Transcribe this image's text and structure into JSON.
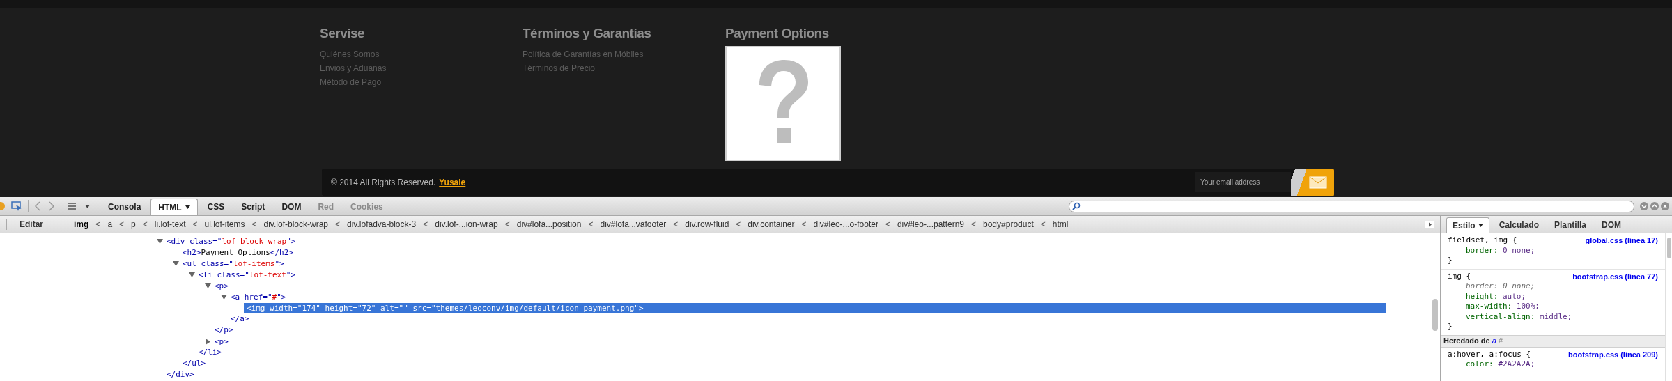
{
  "footer": {
    "columns": [
      {
        "kind": "links",
        "heading": "Servise",
        "links": [
          "Quiénes Somos",
          "Envios y Aduanas",
          "Método de Pago"
        ]
      },
      {
        "kind": "links",
        "heading": "Términos y Garantías",
        "links": [
          "Política de Garantías en Móbiles",
          "Términos de Precio"
        ]
      },
      {
        "kind": "image",
        "heading": "Payment Options"
      }
    ],
    "copyright": "© 2014 All Rights Reserved.",
    "brand_link": "Yusale",
    "email_placeholder": "Your email address"
  },
  "toolbar": {
    "tabs": [
      {
        "label": "Consola",
        "selected": false,
        "disabled": false,
        "dropdown": false
      },
      {
        "label": "HTML",
        "selected": true,
        "disabled": false,
        "dropdown": true
      },
      {
        "label": "CSS",
        "selected": false,
        "disabled": false,
        "dropdown": false
      },
      {
        "label": "Script",
        "selected": false,
        "disabled": false,
        "dropdown": false
      },
      {
        "label": "DOM",
        "selected": false,
        "disabled": false,
        "dropdown": false
      },
      {
        "label": "Red",
        "selected": false,
        "disabled": true,
        "dropdown": false
      },
      {
        "label": "Cookies",
        "selected": false,
        "disabled": true,
        "dropdown": false
      }
    ]
  },
  "breadcrumb": {
    "edit_button": "Editar",
    "crumbs": [
      {
        "label": "img",
        "selected": true
      },
      {
        "separator": "<",
        "label": "a",
        "selected": false
      },
      {
        "separator": "<",
        "label": "p",
        "selected": false
      },
      {
        "separator": "<",
        "label": "li.lof-text",
        "selected": false
      },
      {
        "separator": "<",
        "label": "ul.lof-items",
        "selected": false
      },
      {
        "separator": "<",
        "label": "div.lof-block-wrap",
        "selected": false
      },
      {
        "separator": "<",
        "label": "div.lofadva-block-3",
        "selected": false
      },
      {
        "separator": "<",
        "label": "div.lof-...ion-wrap",
        "selected": false
      },
      {
        "separator": "<",
        "label": "div#lofa...position",
        "selected": false
      },
      {
        "separator": "<",
        "label": "div#lofa...vafooter",
        "selected": false
      },
      {
        "separator": "<",
        "label": "div.row-fluid",
        "selected": false
      },
      {
        "separator": "<",
        "label": "div.container",
        "selected": false
      },
      {
        "separator": "<",
        "label": "div#leo-...o-footer",
        "selected": false
      },
      {
        "separator": "<",
        "label": "div#leo-...pattern9",
        "selected": false
      },
      {
        "separator": "<",
        "label": "body#product",
        "selected": false
      },
      {
        "separator": "<",
        "label": "html",
        "selected": false
      }
    ]
  },
  "html_tree": [
    {
      "markup": "<div class=\"lof-block-wrap\">",
      "expanded": true,
      "selected": false,
      "close": "</div>",
      "children": [
        {
          "markup": "<h2>Payment Options</h2>",
          "selected": false
        },
        {
          "markup": "<ul class=\"lof-items\">",
          "expanded": true,
          "selected": false,
          "close": "</ul>",
          "children": [
            {
              "markup": "<li class=\"lof-text\">",
              "expanded": true,
              "selected": false,
              "close": "</li>",
              "children": [
                {
                  "markup": "<p>",
                  "expanded": true,
                  "selected": false,
                  "close": "</p>",
                  "children": [
                    {
                      "markup": "<a href=\"#\">",
                      "expanded": true,
                      "selected": false,
                      "close": "</a>",
                      "children": [
                        {
                          "markup": "<img width=\"174\" height=\"72\" alt=\"\" src=\"themes/leoconv/img/default/icon-payment.png\">",
                          "selected": true
                        }
                      ]
                    }
                  ]
                },
                {
                  "markup": "<p>",
                  "expanded": false,
                  "selected": false
                }
              ]
            }
          ]
        }
      ]
    }
  ],
  "side_panel": {
    "tabs": [
      {
        "label": "Estilo",
        "selected": true,
        "dropdown": true
      },
      {
        "label": "Calculado",
        "selected": false,
        "dropdown": false
      },
      {
        "label": "Plantilla",
        "selected": false,
        "dropdown": false
      },
      {
        "label": "DOM",
        "selected": false,
        "dropdown": false
      }
    ],
    "rules": [
      {
        "selector": "fieldset, img {",
        "source": "global.css (línea 17)",
        "close": "}",
        "properties": [
          {
            "name": "border:",
            "value": "0 none;",
            "overridden": false
          }
        ]
      },
      {
        "selector": "img {",
        "source": "bootstrap.css (línea 77)",
        "close": "}",
        "properties": [
          {
            "name": "border:",
            "value": "0 none;",
            "overridden": true
          },
          {
            "name": "height:",
            "value": "auto;",
            "overridden": false
          },
          {
            "name": "max-width:",
            "value": "100%;",
            "overridden": false
          },
          {
            "name": "vertical-align:",
            "value": "middle;",
            "overridden": false
          }
        ]
      }
    ],
    "inherited": {
      "label": "Heredado de",
      "element": "a",
      "id": "#"
    },
    "inherited_rules": [
      {
        "selector": "a:hover, a:focus {",
        "source": "bootstrap.css (línea 209)",
        "properties": [
          {
            "name": "color:",
            "value": "#2A2A2A;",
            "overridden": false
          }
        ]
      }
    ]
  }
}
